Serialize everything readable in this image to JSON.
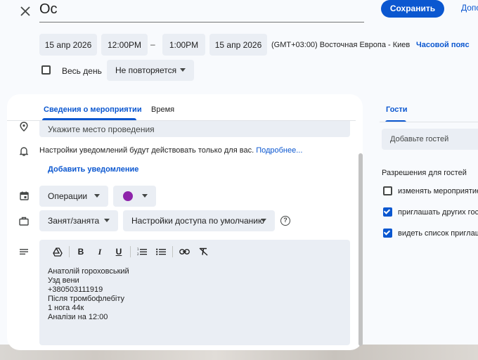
{
  "header": {
    "title_value": "Ос",
    "save_label": "Сохранить",
    "more_label": "Допо"
  },
  "datetime": {
    "start_date": "15 апр 2026",
    "start_time": "12:00PM",
    "separator": "–",
    "end_time": "1:00PM",
    "end_date": "15 апр 2026",
    "timezone": "(GMT+03:00) Восточная Европа - Киев",
    "timezone_link": "Часовой пояс"
  },
  "allday": {
    "label": "Весь день",
    "checked": false,
    "repeat_value": "Не повторяется"
  },
  "tabs": [
    {
      "label": "Сведения о мероприятии",
      "active": true
    },
    {
      "label": "Время",
      "active": false
    }
  ],
  "details": {
    "location_placeholder": "Укажите место проведения",
    "notification_text": "Настройки уведомлений будут действовать только для вас.",
    "notification_link": "Подробнее...",
    "add_notification": "Добавить уведомление",
    "calendar_value": "Операции",
    "event_color": "#8e24aa",
    "busy_value": "Занят/занята",
    "visibility_value": "Настройки доступа по умолчанию",
    "help_glyph": "?"
  },
  "editor": {
    "toolbar": [
      "drive-icon",
      "bold-icon",
      "italic-icon",
      "underline-icon",
      "numbered-list-icon",
      "bulleted-list-icon",
      "link-icon",
      "clear-format-icon"
    ],
    "bold_glyph": "B",
    "italic_glyph": "I",
    "underline_glyph": "U",
    "lines": [
      "Анатолій гороховський",
      "Узд вени",
      "+380503111919",
      "Після тромбофлебіту",
      "1 нога 44к",
      "Аналізи на 12:00"
    ]
  },
  "guests": {
    "tab_label": "Гости",
    "input_placeholder": "Добавьте гостей",
    "permissions_title": "Разрешения для гостей",
    "permissions": [
      {
        "label": "изменять мероприятие",
        "checked": false
      },
      {
        "label": "приглашать других гост",
        "checked": true
      },
      {
        "label": "видеть список приглаш",
        "checked": true
      }
    ]
  },
  "colors": {
    "accent": "#0b57d0",
    "field_bg": "#eaeef4",
    "page_bg": "#f8fafd"
  }
}
